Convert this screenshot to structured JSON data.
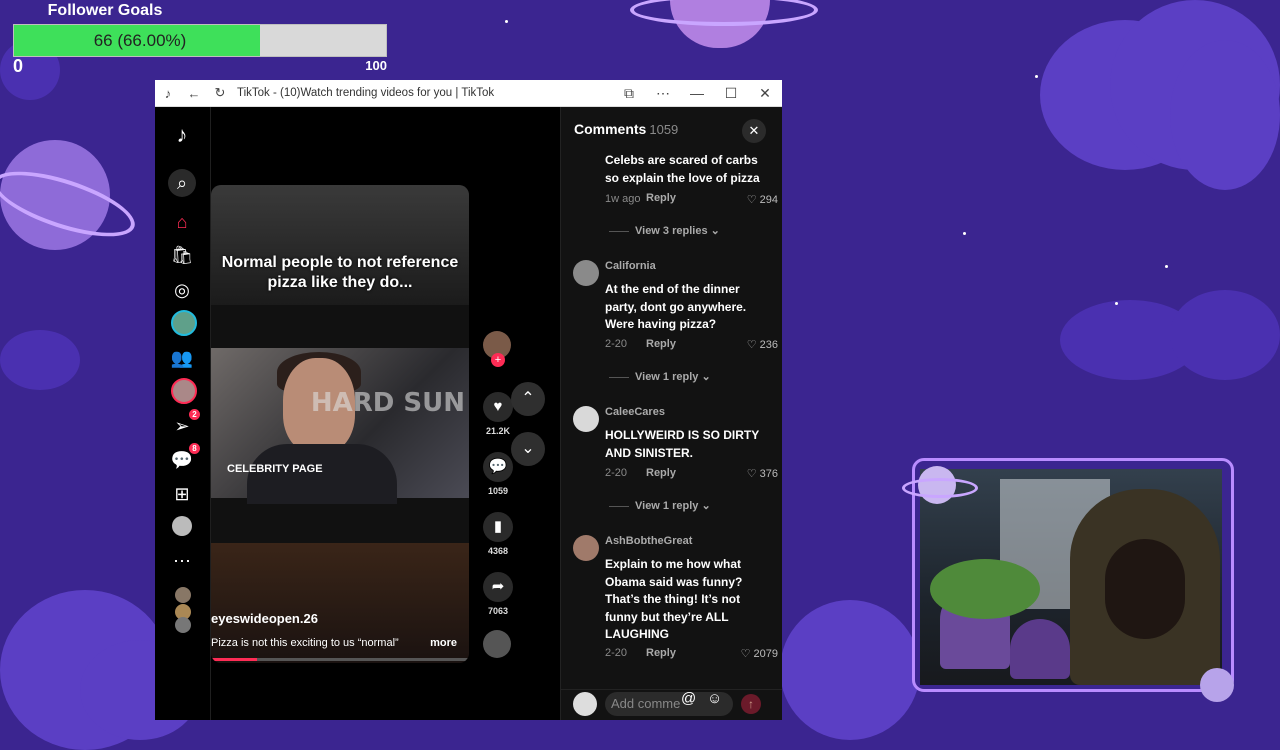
{
  "goal": {
    "title": "Follower Goals",
    "text": "66 (66.00%)",
    "progress": 0.66,
    "min": "0",
    "max": "100"
  },
  "browser": {
    "title": "TikTok - (10)Watch trending videos for you | TikTok"
  },
  "nav": {
    "badge_activity": "2",
    "badge_messages": "8"
  },
  "video": {
    "caption": "Normal people to not reference pizza like they do...",
    "logo": "CELEBRITY PAGE",
    "bg_text": "HARD SUN",
    "username": "eyeswideopen.26",
    "description": "Pizza is not this exciting to us “normal”",
    "more": "more",
    "progress": 0.18,
    "likes": "21.2K",
    "comments": "1059",
    "saves": "4368",
    "shares": "7063"
  },
  "comments": {
    "title": "Comments",
    "count": "1059",
    "items": [
      {
        "name": "",
        "text": "Celebs are scared of carbs so explain the love of pizza",
        "time": "1w ago",
        "reply": "Reply",
        "likes": "294",
        "view": "View 3 replies"
      },
      {
        "name": "California",
        "text": "At the end of the dinner party, dont go anywhere. Were having pizza?",
        "time": "2-20",
        "reply": "Reply",
        "likes": "236",
        "view": "View 1 reply"
      },
      {
        "name": "CaleeCares",
        "text": "HOLLYWEIRD IS SO DIRTY AND SINISTER.",
        "time": "2-20",
        "reply": "Reply",
        "likes": "376",
        "view": "View 1 reply"
      },
      {
        "name": "AshBobtheGreat",
        "text": "Explain to me how what Obama said was funny? That’s the thing! It’s not funny but they’re ALL LAUGHING",
        "time": "2-20",
        "reply": "Reply",
        "likes": "2079",
        "view": ""
      }
    ],
    "input_placeholder": "Add comme"
  },
  "colors": {
    "accent": "#fe2c55",
    "goal_fill": "#3ee05a",
    "bg": "#3b2590"
  }
}
